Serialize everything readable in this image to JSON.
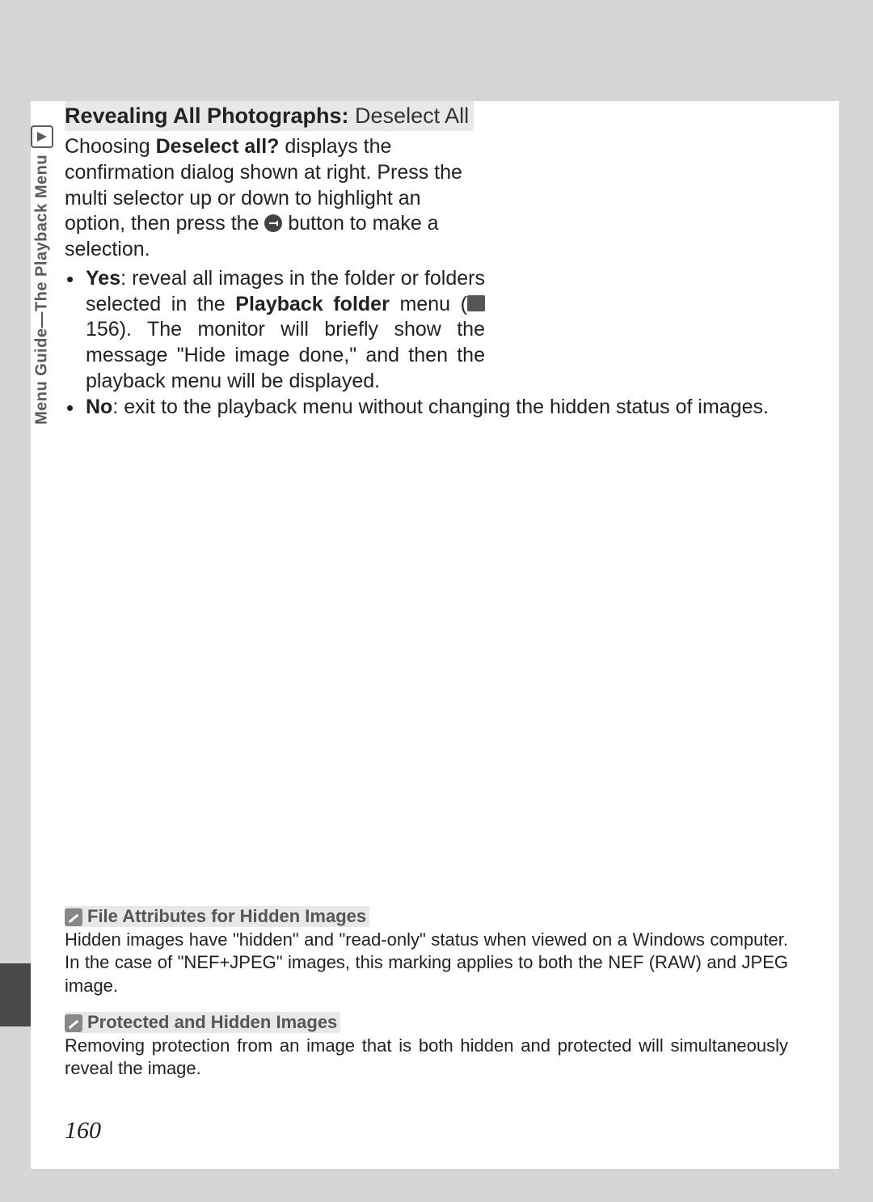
{
  "sidebar": {
    "tab_label": "Menu Guide—The Playback Menu"
  },
  "heading": {
    "bold": "Revealing All Photographs: ",
    "light": "Deselect All"
  },
  "intro": {
    "part1": "Choosing ",
    "bold1": "Deselect all?",
    "part2": " displays the confirmation dialog shown at right.  Press the multi selector up or down to highlight an option, then press the ",
    "part3": " button to make a selection."
  },
  "bullets": {
    "yes": {
      "label": "Yes",
      "part1": ": reveal all images in the folder or folders selected in the ",
      "bold1": "Playback folder",
      "part2": " menu (",
      "ref": " 156",
      "part3": ").  The monitor will briefly show the message \"Hide image done,\" and then the playback menu will be displayed."
    },
    "no": {
      "label": "No",
      "text": ": exit to the playback menu without changing the hidden status of images."
    }
  },
  "notes": {
    "a": {
      "title": "File Attributes for Hidden Images",
      "body": "Hidden images have \"hidden\" and \"read-only\" status when viewed on a Windows computer.  In the case of \"NEF+JPEG\" images, this marking applies to both the NEF (RAW) and JPEG image."
    },
    "b": {
      "title": "Protected and Hidden Images",
      "body": "Removing protection from an image that is both hidden and protected will simultaneously reveal the image."
    }
  },
  "page_number": "160"
}
